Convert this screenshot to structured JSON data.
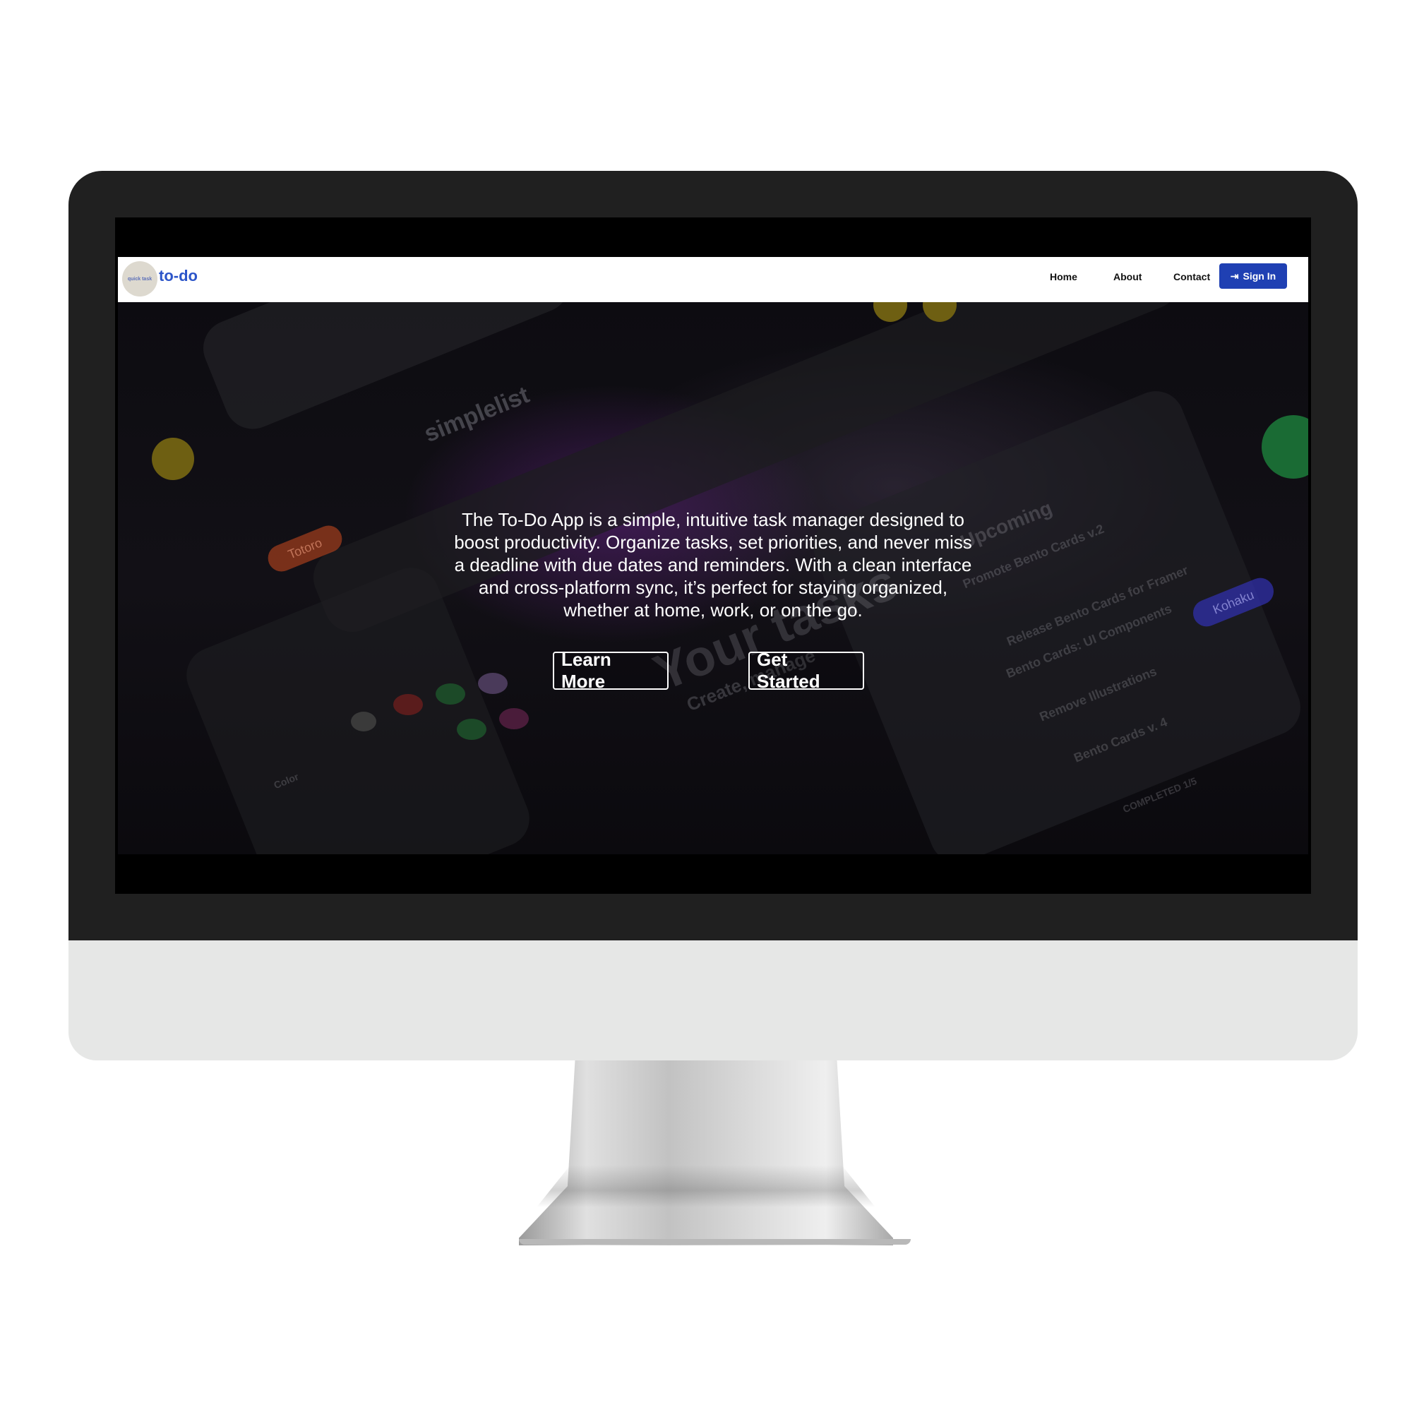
{
  "nav": {
    "logo_text": "quick task",
    "brand": "to-do",
    "links": [
      "Home",
      "About",
      "Contact"
    ],
    "signin_label": "Sign In",
    "signin_icon": "sign-in-icon"
  },
  "hero": {
    "description": "The To-Do App is a simple, intuitive task manager designed to boost productivity. Organize tasks, set priorities, and never miss a deadline with due dates and reminders. With a clean interface and cross-platform sync, it’s perfect for staying organized, whether at home, work, or on the go.",
    "learn_more": "Learn More",
    "get_started": "Get Started"
  },
  "background": {
    "app_name": "simplelist",
    "tag_left": "Totoro",
    "tag_right": "Kohaku",
    "section": "Upcoming",
    "tasks": [
      "Promote Bento Cards v.2",
      "Release Bento Cards for Framer",
      "Bento Cards: UI Components",
      "Remove Illustrations",
      "Bento Cards v. 4"
    ],
    "completed": "COMPLETED 1/5",
    "big_text": "Your tasks",
    "sub_text": "Create, manage",
    "color_label": "Color"
  },
  "colors": {
    "brand_blue": "#2c55c9",
    "signin_bg": "#1f40b3",
    "bezel": "#202020",
    "chin": "#e6e7e6"
  }
}
